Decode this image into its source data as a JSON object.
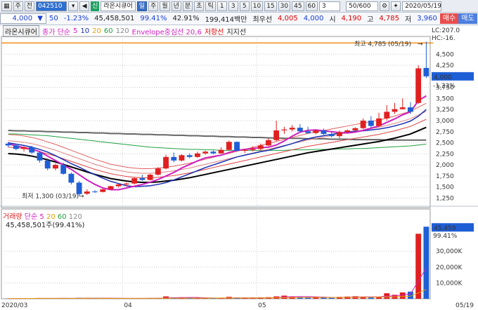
{
  "toolbar": {
    "grid_icon": "grid-icon",
    "type_label": "주",
    "type2_label": "전",
    "code": "042510",
    "name": "라온시큐어",
    "shin": "신",
    "periods": [
      "일",
      "주",
      "월",
      "년",
      "분",
      "초",
      "틱"
    ],
    "selected_period": "일",
    "minutes": [
      "1",
      "3",
      "5",
      "10",
      "15",
      "30",
      "45",
      "60"
    ],
    "count_value": "3",
    "range": "50/600",
    "date": "2020/05/19"
  },
  "quote": {
    "price": "4,000",
    "change": "50",
    "change_rate": "-1.23%",
    "volume": "45,458,501",
    "volume_rate": "99.41%",
    "turnover_rate": "42.91%",
    "amount": "199,414백만",
    "best_label": "최우선",
    "best_price1": "4,005",
    "best_price2": "4,000",
    "open_label": "시",
    "open": "4,190",
    "high_label": "고",
    "high": "4,785",
    "low_label": "저",
    "low": "3,960",
    "buy_label": "매수",
    "sell_label": "매도"
  },
  "legend": {
    "name": "라온시큐어",
    "ma_label": "종가 단순",
    "ma_periods": [
      "5",
      "10",
      "20",
      "60",
      "120"
    ],
    "envelope_label": "Envelope중심선 20,6",
    "resistance_label": "저항선",
    "support_label": "지지선"
  },
  "annotations": {
    "high": "최고 4,785 (05/19)",
    "low": "최저 1,300 (03/19)",
    "lc": "LC:207.0",
    "hc": "HC:-16.",
    "price_tag": "4,000",
    "pct_tag": "-1.23%",
    "vol_tag": "45,459",
    "vol_pct_tag": "99.41%"
  },
  "price_axis": [
    "4,500",
    "4,250",
    "4,000",
    "3,750",
    "3,500",
    "3,250",
    "3,000",
    "2,750",
    "2,500",
    "2,250",
    "2,000",
    "1,750",
    "1,500",
    "1,250"
  ],
  "volume_legend": {
    "label": "거래량",
    "ma_label": "단순",
    "periods": [
      "5",
      "20",
      "60",
      "120"
    ],
    "summary": "45,458,501주(99.41%)"
  },
  "volume_axis": [
    "30,000K",
    "20,000K",
    "10,000K"
  ],
  "x_axis": [
    "2020/03",
    "04",
    "05",
    "05/19"
  ],
  "colors": {
    "up": "#e02020",
    "down": "#1f5fd6",
    "ma5": "#d020c0",
    "ma10": "#1a2fb0",
    "ma20": "#e8a000",
    "ma60": "#20a040",
    "ma120": "#666666"
  },
  "chart_data": {
    "type": "candlestick",
    "ylim": [
      1100,
      4900
    ],
    "candles": [
      {
        "o": 2480,
        "h": 2520,
        "l": 2400,
        "c": 2440
      },
      {
        "o": 2440,
        "h": 2470,
        "l": 2330,
        "c": 2360
      },
      {
        "o": 2360,
        "h": 2420,
        "l": 2300,
        "c": 2400
      },
      {
        "o": 2400,
        "h": 2430,
        "l": 2250,
        "c": 2280
      },
      {
        "o": 2280,
        "h": 2300,
        "l": 2050,
        "c": 2100
      },
      {
        "o": 2100,
        "h": 2150,
        "l": 1880,
        "c": 1920
      },
      {
        "o": 1920,
        "h": 2030,
        "l": 1880,
        "c": 2000
      },
      {
        "o": 2000,
        "h": 2050,
        "l": 1780,
        "c": 1800
      },
      {
        "o": 1800,
        "h": 1830,
        "l": 1560,
        "c": 1600
      },
      {
        "o": 1600,
        "h": 1640,
        "l": 1300,
        "c": 1340
      },
      {
        "o": 1350,
        "h": 1450,
        "l": 1320,
        "c": 1400
      },
      {
        "o": 1400,
        "h": 1430,
        "l": 1370,
        "c": 1390
      },
      {
        "o": 1390,
        "h": 1460,
        "l": 1380,
        "c": 1450
      },
      {
        "o": 1450,
        "h": 1530,
        "l": 1440,
        "c": 1520
      },
      {
        "o": 1520,
        "h": 1570,
        "l": 1490,
        "c": 1560
      },
      {
        "o": 1560,
        "h": 1600,
        "l": 1520,
        "c": 1580
      },
      {
        "o": 1580,
        "h": 1720,
        "l": 1560,
        "c": 1700
      },
      {
        "o": 1700,
        "h": 1780,
        "l": 1640,
        "c": 1660
      },
      {
        "o": 1660,
        "h": 1800,
        "l": 1650,
        "c": 1780
      },
      {
        "o": 1780,
        "h": 1950,
        "l": 1760,
        "c": 1920
      },
      {
        "o": 1920,
        "h": 2230,
        "l": 1900,
        "c": 2180
      },
      {
        "o": 2180,
        "h": 2280,
        "l": 2060,
        "c": 2100
      },
      {
        "o": 2100,
        "h": 2240,
        "l": 2080,
        "c": 2220
      },
      {
        "o": 2220,
        "h": 2260,
        "l": 2150,
        "c": 2180
      },
      {
        "o": 2180,
        "h": 2300,
        "l": 2160,
        "c": 2260
      },
      {
        "o": 2260,
        "h": 2320,
        "l": 2230,
        "c": 2300
      },
      {
        "o": 2300,
        "h": 2330,
        "l": 2240,
        "c": 2260
      },
      {
        "o": 2260,
        "h": 2400,
        "l": 2250,
        "c": 2340
      },
      {
        "o": 2340,
        "h": 2550,
        "l": 2320,
        "c": 2520
      },
      {
        "o": 2520,
        "h": 2530,
        "l": 2300,
        "c": 2320
      },
      {
        "o": 2320,
        "h": 2360,
        "l": 2270,
        "c": 2340
      },
      {
        "o": 2340,
        "h": 2420,
        "l": 2310,
        "c": 2360
      },
      {
        "o": 2360,
        "h": 2480,
        "l": 2330,
        "c": 2440
      },
      {
        "o": 2440,
        "h": 2600,
        "l": 2420,
        "c": 2560
      },
      {
        "o": 2560,
        "h": 3000,
        "l": 2540,
        "c": 2780
      },
      {
        "o": 2780,
        "h": 2860,
        "l": 2700,
        "c": 2800
      },
      {
        "o": 2800,
        "h": 2900,
        "l": 2760,
        "c": 2840
      },
      {
        "o": 2840,
        "h": 2920,
        "l": 2740,
        "c": 2760
      },
      {
        "o": 2760,
        "h": 2860,
        "l": 2700,
        "c": 2720
      },
      {
        "o": 2720,
        "h": 2800,
        "l": 2690,
        "c": 2780
      },
      {
        "o": 2780,
        "h": 2820,
        "l": 2680,
        "c": 2700
      },
      {
        "o": 2700,
        "h": 2760,
        "l": 2620,
        "c": 2650
      },
      {
        "o": 2650,
        "h": 2780,
        "l": 2600,
        "c": 2740
      },
      {
        "o": 2740,
        "h": 2800,
        "l": 2710,
        "c": 2780
      },
      {
        "o": 2780,
        "h": 2850,
        "l": 2740,
        "c": 2830
      },
      {
        "o": 2830,
        "h": 3050,
        "l": 2810,
        "c": 3000
      },
      {
        "o": 3000,
        "h": 3100,
        "l": 2840,
        "c": 2880
      },
      {
        "o": 2880,
        "h": 3180,
        "l": 2860,
        "c": 3050
      },
      {
        "o": 3050,
        "h": 3350,
        "l": 3000,
        "c": 3200
      },
      {
        "o": 3200,
        "h": 3400,
        "l": 3150,
        "c": 3260
      },
      {
        "o": 3260,
        "h": 3500,
        "l": 3250,
        "c": 3300
      },
      {
        "o": 3300,
        "h": 3420,
        "l": 3150,
        "c": 3200
      },
      {
        "o": 3400,
        "h": 4250,
        "l": 3380,
        "c": 4180
      },
      {
        "o": 4190,
        "h": 4785,
        "l": 3960,
        "c": 4000
      }
    ],
    "ma5": [
      2480,
      2430,
      2390,
      2360,
      2300,
      2200,
      2100,
      2000,
      1900,
      1780,
      1660,
      1560,
      1480,
      1440,
      1440,
      1480,
      1520,
      1560,
      1610,
      1670,
      1750,
      1830,
      1930,
      2010,
      2090,
      2160,
      2190,
      2220,
      2280,
      2330,
      2350,
      2370,
      2390,
      2400,
      2450,
      2540,
      2650,
      2740,
      2780,
      2790,
      2770,
      2750,
      2730,
      2720,
      2740,
      2780,
      2830,
      2880,
      2960,
      3040,
      3130,
      3200,
      3450,
      3560
    ],
    "ma10": [
      2500,
      2470,
      2440,
      2400,
      2350,
      2290,
      2210,
      2120,
      2030,
      1950,
      1860,
      1780,
      1700,
      1630,
      1580,
      1530,
      1510,
      1520,
      1530,
      1560,
      1600,
      1660,
      1730,
      1800,
      1870,
      1940,
      2000,
      2060,
      2120,
      2180,
      2220,
      2260,
      2300,
      2330,
      2380,
      2430,
      2480,
      2540,
      2590,
      2630,
      2660,
      2690,
      2720,
      2740,
      2760,
      2770,
      2790,
      2810,
      2840,
      2880,
      2930,
      2990,
      3100,
      3250
    ],
    "ma20": [
      2520,
      2510,
      2490,
      2470,
      2440,
      2400,
      2360,
      2310,
      2250,
      2190,
      2130,
      2070,
      2010,
      1960,
      1910,
      1870,
      1840,
      1810,
      1790,
      1780,
      1780,
      1790,
      1800,
      1820,
      1850,
      1880,
      1910,
      1950,
      1990,
      2030,
      2070,
      2110,
      2150,
      2190,
      2230,
      2270,
      2310,
      2350,
      2390,
      2430,
      2470,
      2500,
      2530,
      2560,
      2590,
      2610,
      2640,
      2660,
      2700,
      2740,
      2790,
      2840,
      2920,
      3010
    ],
    "ma60": [
      2700,
      2700,
      2690,
      2680,
      2670,
      2660,
      2640,
      2620,
      2600,
      2580,
      2560,
      2540,
      2520,
      2500,
      2480,
      2460,
      2440,
      2420,
      2400,
      2390,
      2380,
      2370,
      2360,
      2350,
      2350,
      2340,
      2340,
      2330,
      2330,
      2330,
      2330,
      2330,
      2330,
      2330,
      2330,
      2330,
      2340,
      2340,
      2340,
      2350,
      2350,
      2350,
      2360,
      2360,
      2370,
      2370,
      2380,
      2390,
      2400,
      2410,
      2420,
      2430,
      2450,
      2470
    ],
    "ma120": [
      2780,
      2770,
      2770,
      2760,
      2760,
      2750,
      2750,
      2740,
      2740,
      2730,
      2730,
      2720,
      2720,
      2710,
      2710,
      2700,
      2700,
      2690,
      2690,
      2680,
      2680,
      2670,
      2670,
      2660,
      2660,
      2650,
      2650,
      2640,
      2640,
      2630,
      2630,
      2620,
      2620,
      2610,
      2610,
      2600,
      2600,
      2600,
      2590,
      2590,
      2590,
      2580,
      2580,
      2580,
      2570,
      2570,
      2570,
      2570,
      2560,
      2560,
      2560,
      2560,
      2560,
      2560
    ],
    "env_mid": [
      2400,
      2390,
      2370,
      2340,
      2300,
      2250,
      2200,
      2140,
      2080,
      2020,
      1960,
      1900,
      1850,
      1800,
      1770,
      1740,
      1720,
      1710,
      1710,
      1720,
      1740,
      1760,
      1790,
      1820,
      1860,
      1900,
      1940,
      1980,
      2020,
      2060,
      2100,
      2140,
      2180,
      2220,
      2260,
      2300,
      2340,
      2380,
      2420,
      2450,
      2480,
      2510,
      2540,
      2570,
      2600,
      2630,
      2660,
      2690,
      2730,
      2770,
      2820,
      2870,
      2950,
      3030
    ],
    "volumes": [
      0.15,
      0.2,
      0.15,
      0.4,
      0.35,
      0.3,
      0.25,
      0.3,
      0.3,
      0.6,
      0.4,
      0.3,
      0.25,
      0.3,
      0.3,
      0.25,
      0.3,
      0.3,
      0.4,
      0.4,
      1.5,
      0.8,
      0.9,
      0.5,
      0.4,
      0.5,
      0.3,
      0.4,
      1.2,
      0.6,
      0.5,
      0.4,
      0.6,
      1.0,
      1.5,
      2.0,
      1.5,
      1.0,
      0.8,
      0.9,
      1.0,
      0.6,
      1.2,
      1.4,
      1.6,
      1.2,
      0.8,
      1.2,
      3.5,
      2.5,
      4.0,
      4.5,
      41.0,
      45.46
    ],
    "vol_ylim": [
      0,
      46
    ],
    "x_ticks": [
      {
        "i": 0,
        "label": "2020/03"
      },
      {
        "i": 15,
        "label": "04"
      },
      {
        "i": 32,
        "label": "05"
      },
      {
        "i": 53,
        "label": "05/19"
      }
    ],
    "resistance": 4785,
    "high": {
      "value": 4785,
      "date": "05/19"
    },
    "low": {
      "value": 1300,
      "date": "03/19"
    }
  }
}
